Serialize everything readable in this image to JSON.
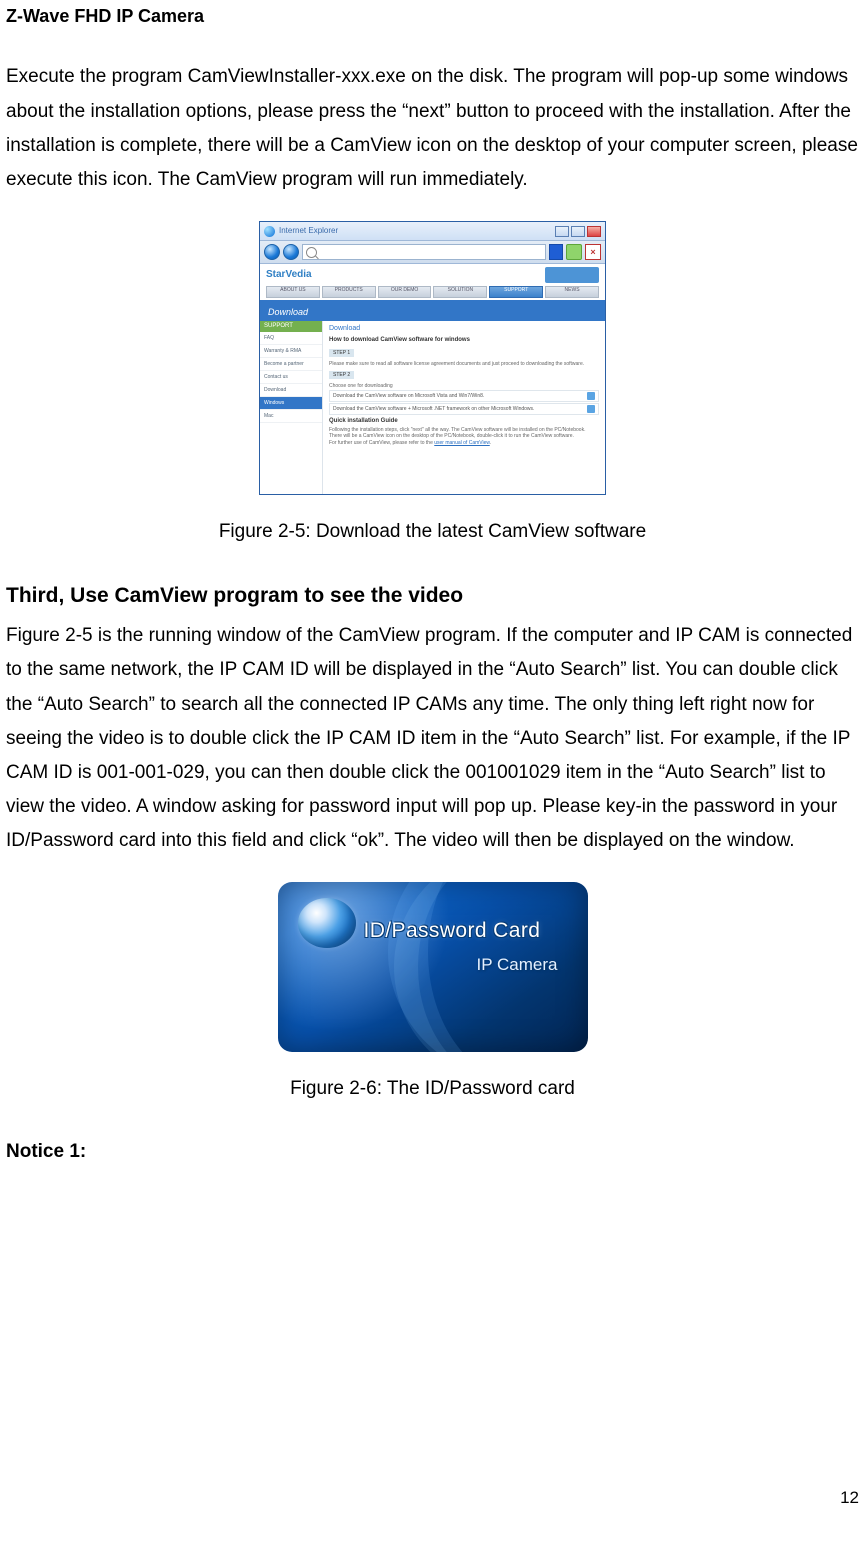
{
  "header": {
    "title": "Z-Wave FHD IP Camera"
  },
  "paragraphs": {
    "p1": "Execute the program CamViewInstaller-xxx.exe on the disk. The program will pop-up some windows about the installation options, please press the “next” button to proceed with the installation. After the installation is complete, there will be a CamView icon on the desktop of your computer screen, please execute this icon. The CamView program will run immediately.",
    "p2": "Figure 2-5 is the running window of the CamView program. If the computer and IP CAM is connected to the same network, the IP CAM ID will be displayed in the “Auto Search” list. You can double click the “Auto Search” to search all the connected IP CAMs any time. The only thing left right now for seeing the video is to double click the IP CAM ID item in the “Auto Search” list. For example, if the IP CAM ID is 001-001-029, you can then double click the 001001029 item in the “Auto Search” list to view the video. A window asking for password input will pop up. Please key-in the password in your ID/Password card into this field and click “ok”. The video will then be displayed on the window."
  },
  "section": {
    "title2": "Third, Use CamView program to see the video"
  },
  "figures": {
    "f25": "Figure 2-5: Download the latest CamView software",
    "f26": "Figure 2-6: The ID/Password card"
  },
  "notice": {
    "heading": "Notice 1:"
  },
  "pageNumber": "12",
  "browserMock": {
    "titlebar": "Internet Explorer",
    "brand": "StarVedia",
    "menu": {
      "about": "ABOUT US",
      "products": "PRODUCTS",
      "ourdemo": "OUR DEMO",
      "solution": "SOLUTION",
      "support": "SUPPORT",
      "news": "NEWS"
    },
    "dlHeader": "Download",
    "side": {
      "heading": "SUPPORT",
      "faq": "FAQ",
      "warranty": "Warranty & RMA",
      "partner": "Become a partner",
      "contact": "Contact us",
      "download": "Download",
      "windows": "Windows",
      "mac": "Mac"
    },
    "page": {
      "dlTitle": "Download",
      "sub": "How to download CamView software for windows",
      "step1": "STEP 1",
      "line1": "Please make sure to read all software license agreement documents and just proceed to downloading the software.",
      "step2": "STEP 2",
      "line2": "Choose one for downloading",
      "row1": "Download the CamView software on Microsoft Vista and Win7/Win8.",
      "row2": "Download the CamView software + Microsoft .NET framework on other Microsoft Windows.",
      "guide": "Quick installation Guide",
      "line3": "Following the installation steps, click \"next\" all the way. The CamView software will be installed on the PC/Notebook. There will be a CamView icon on the desktop of the PC/Notebook, double-click it to run the CamView software.",
      "line4a": "For further use of CamView, please refer to the ",
      "line4link": "user manual of CamView"
    }
  },
  "card": {
    "title": "ID/Password Card",
    "sub": "IP Camera"
  }
}
